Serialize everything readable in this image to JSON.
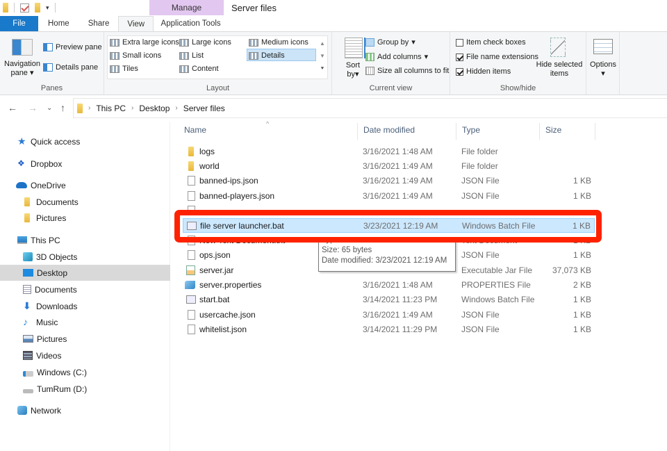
{
  "window": {
    "title": "Server files",
    "context_tab_group": "Manage"
  },
  "quick_access_toolbar": {
    "icons": [
      "folder-icon",
      "properties-check-icon",
      "new-folder-icon",
      "customize-dropdown-icon"
    ]
  },
  "ribbon_tabs": [
    {
      "label": "File",
      "active": false
    },
    {
      "label": "Home",
      "active": false
    },
    {
      "label": "Share",
      "active": false
    },
    {
      "label": "View",
      "active": true
    },
    {
      "label": "Application Tools",
      "active": false
    }
  ],
  "ribbon": {
    "panes": {
      "label": "Panes",
      "navigation_pane": "Navigation pane",
      "navigation_pane_line1": "Navigation",
      "navigation_pane_line2": "pane",
      "preview_pane": "Preview pane",
      "details_pane": "Details pane"
    },
    "layout": {
      "label": "Layout",
      "options": [
        "Extra large icons",
        "Large icons",
        "Medium icons",
        "Small icons",
        "List",
        "Details",
        "Tiles",
        "Content"
      ],
      "selected": "Details"
    },
    "current_view": {
      "label": "Current view",
      "sort_by_line1": "Sort",
      "sort_by_line2": "by",
      "group_by": "Group by",
      "add_columns": "Add columns",
      "size_all_columns": "Size all columns to fit"
    },
    "show_hide": {
      "label": "Show/hide",
      "item_check_boxes": {
        "label": "Item check boxes",
        "checked": false
      },
      "file_name_extensions": {
        "label": "File name extensions",
        "checked": true
      },
      "hidden_items": {
        "label": "Hidden items",
        "checked": true
      },
      "hide_selected_line1": "Hide selected",
      "hide_selected_line2": "items"
    },
    "options": {
      "label": "Options"
    }
  },
  "address_bar": {
    "breadcrumb": [
      "This PC",
      "Desktop",
      "Server files"
    ]
  },
  "sidebar": {
    "items": [
      {
        "label": "Quick access",
        "icon": "star-icon",
        "level": 0
      },
      {
        "label": "Dropbox",
        "icon": "dropbox-icon",
        "level": 0
      },
      {
        "label": "OneDrive",
        "icon": "cloud-icon",
        "level": 0
      },
      {
        "label": "Documents",
        "icon": "folder-icon",
        "level": 1
      },
      {
        "label": "Pictures",
        "icon": "folder-icon",
        "level": 1
      },
      {
        "label": "This PC",
        "icon": "computer-icon",
        "level": 0
      },
      {
        "label": "3D Objects",
        "icon": "cube-icon",
        "level": 1
      },
      {
        "label": "Desktop",
        "icon": "desktop-icon",
        "level": 1,
        "selected": true
      },
      {
        "label": "Documents",
        "icon": "documents-icon",
        "level": 1
      },
      {
        "label": "Downloads",
        "icon": "download-icon",
        "level": 1
      },
      {
        "label": "Music",
        "icon": "music-icon",
        "level": 1
      },
      {
        "label": "Pictures",
        "icon": "pictures-icon",
        "level": 1
      },
      {
        "label": "Videos",
        "icon": "film-icon",
        "level": 1
      },
      {
        "label": "Windows (C:)",
        "icon": "drive-c-icon",
        "level": 1
      },
      {
        "label": "TumRum (D:)",
        "icon": "drive-icon",
        "level": 1
      },
      {
        "label": "Network",
        "icon": "network-icon",
        "level": 0
      }
    ]
  },
  "file_list": {
    "columns": [
      "Name",
      "Date modified",
      "Type",
      "Size"
    ],
    "rows": [
      {
        "name": "logs",
        "date": "3/16/2021 1:48 AM",
        "type": "File folder",
        "size": "",
        "icon": "folder"
      },
      {
        "name": "world",
        "date": "3/16/2021 1:49 AM",
        "type": "File folder",
        "size": "",
        "icon": "folder"
      },
      {
        "name": "banned-ips.json",
        "date": "3/16/2021 1:49 AM",
        "type": "JSON File",
        "size": "1 KB",
        "icon": "doc"
      },
      {
        "name": "banned-players.json",
        "date": "3/16/2021 1:49 AM",
        "type": "JSON File",
        "size": "1 KB",
        "icon": "doc"
      },
      {
        "name": "",
        "date": "",
        "type": "",
        "size": "",
        "icon": "doc",
        "obscured": true
      },
      {
        "name": "file server launcher.bat",
        "date": "3/23/2021 12:19 AM",
        "type": "Windows Batch File",
        "size": "1 KB",
        "icon": "bat",
        "selected": true
      },
      {
        "name": "New Text Document.txt",
        "date": "",
        "type": "Text Document",
        "size": "1 KB",
        "icon": "doc",
        "obscured": true
      },
      {
        "name": "ops.json",
        "date": "",
        "type": "JSON File",
        "size": "1 KB",
        "icon": "doc"
      },
      {
        "name": "server.jar",
        "date": "",
        "type": "Executable Jar File",
        "size": "37,073 KB",
        "icon": "jar"
      },
      {
        "name": "server.properties",
        "date": "3/16/2021 1:48 AM",
        "type": "PROPERTIES File",
        "size": "2 KB",
        "icon": "prop"
      },
      {
        "name": "start.bat",
        "date": "3/14/2021 11:23 PM",
        "type": "Windows Batch File",
        "size": "1 KB",
        "icon": "bat"
      },
      {
        "name": "usercache.json",
        "date": "3/16/2021 1:49 AM",
        "type": "JSON File",
        "size": "1 KB",
        "icon": "doc"
      },
      {
        "name": "whitelist.json",
        "date": "3/14/2021 11:29 PM",
        "type": "JSON File",
        "size": "1 KB",
        "icon": "doc"
      }
    ]
  },
  "tooltip": {
    "type_line": "Type: Windows Batch File",
    "size_line": "Size: 65 bytes",
    "date_line": "Date modified: 3/23/2021 12:19 AM"
  },
  "colors": {
    "file_tab": "#1979ca",
    "manage_tab": "#e2c7f0",
    "selection": "#cce8ff",
    "highlight_annotation": "#ff2200"
  }
}
